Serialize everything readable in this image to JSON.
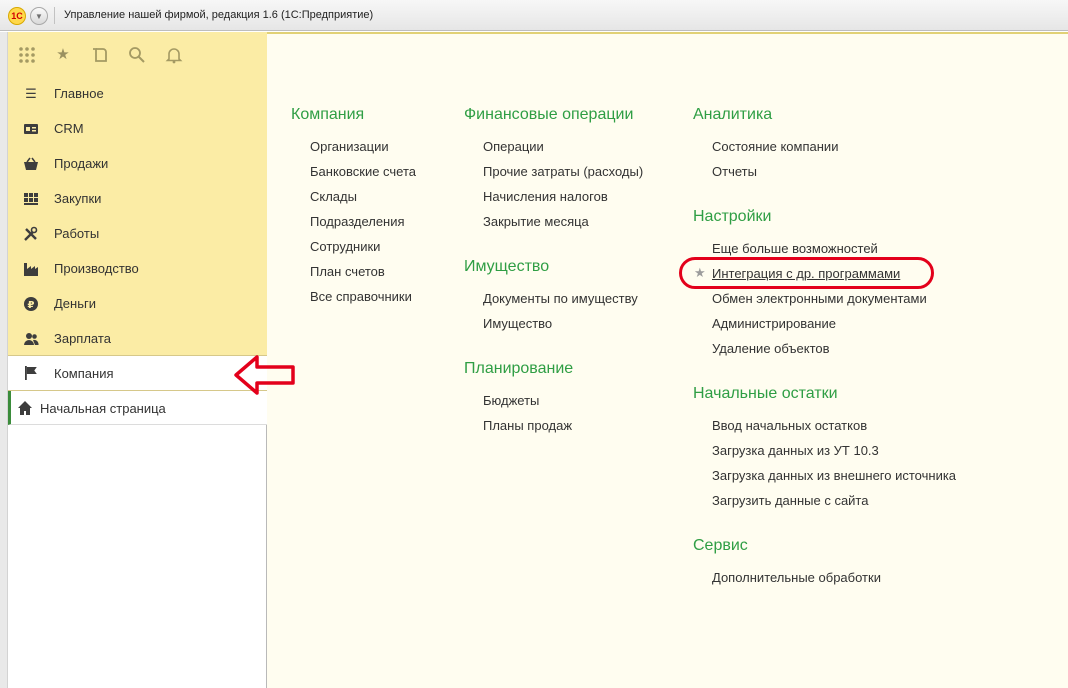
{
  "window": {
    "title": "Управление нашей фирмой, редакция 1.6  (1С:Предприятие)",
    "logo_text": "1С"
  },
  "toolbar": {
    "icons": [
      "apps-grid-icon",
      "star-icon",
      "history-icon",
      "search-icon",
      "bell-icon"
    ]
  },
  "sections": [
    {
      "label": "Главное",
      "icon": "menu-lines-icon"
    },
    {
      "label": "CRM",
      "icon": "contact-card-icon"
    },
    {
      "label": "Продажи",
      "icon": "basket-icon"
    },
    {
      "label": "Закупки",
      "icon": "warehouse-icon"
    },
    {
      "label": "Работы",
      "icon": "tools-icon"
    },
    {
      "label": "Производство",
      "icon": "factory-icon"
    },
    {
      "label": "Деньги",
      "icon": "ruble-icon"
    },
    {
      "label": "Зарплата",
      "icon": "people-icon"
    },
    {
      "label": "Компания",
      "icon": "flag-icon",
      "active": true
    }
  ],
  "home_tab": {
    "label": "Начальная страница",
    "icon": "home-icon"
  },
  "groups": {
    "company": {
      "title": "Компания",
      "items": [
        "Организации",
        "Банковские счета",
        "Склады",
        "Подразделения",
        "Сотрудники",
        "План счетов",
        "Все справочники"
      ]
    },
    "finance": {
      "title": "Финансовые операции",
      "items": [
        "Операции",
        "Прочие затраты (расходы)",
        "Начисления налогов",
        "Закрытие месяца"
      ]
    },
    "property": {
      "title": "Имущество",
      "items": [
        "Документы по имуществу",
        "Имущество"
      ]
    },
    "planning": {
      "title": "Планирование",
      "items": [
        "Бюджеты",
        "Планы продаж"
      ]
    },
    "analytics": {
      "title": "Аналитика",
      "items": [
        "Состояние компании",
        "Отчеты"
      ]
    },
    "settings": {
      "title": "Настройки",
      "items": [
        "Еще больше возможностей",
        "Интеграция с др. программами",
        "Обмен электронными документами",
        "Администрирование",
        "Удаление объектов"
      ]
    },
    "initial": {
      "title": "Начальные остатки",
      "items": [
        "Ввод начальных остатков",
        "Загрузка данных из УТ 10.3",
        "Загрузка данных из внешнего источника",
        "Загрузить данные с сайта"
      ]
    },
    "service": {
      "title": "Сервис",
      "items": [
        "Дополнительные обработки"
      ]
    }
  },
  "colors": {
    "sections_background": "#fbeca5",
    "main_background": "#fffdf0",
    "group_title": "#2f9e44",
    "annotation": "#e3001b"
  }
}
